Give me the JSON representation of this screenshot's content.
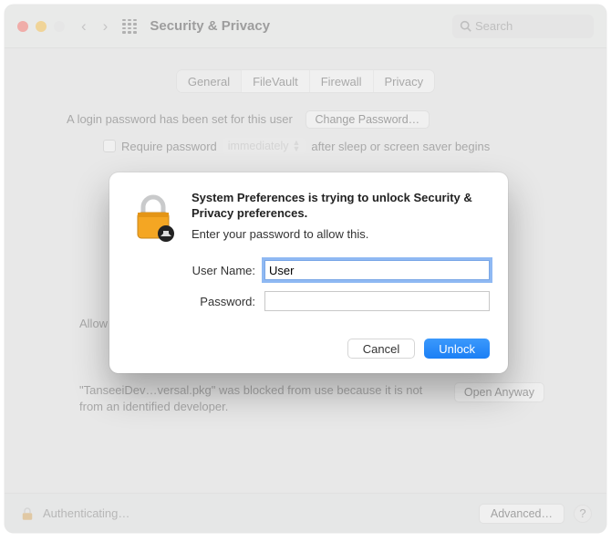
{
  "header": {
    "title": "Security & Privacy",
    "search_placeholder": "Search"
  },
  "tabs": [
    "General",
    "FileVault",
    "Firewall",
    "Privacy"
  ],
  "active_tab": 0,
  "content": {
    "login_password_text": "A login password has been set for this user",
    "change_password_label": "Change Password…",
    "require_password_label": "Require password",
    "require_password_delay": "immediately",
    "require_password_suffix": "after sleep or screen saver begins",
    "allow_prefix": "Allow",
    "blocked_text": "\"TanseeiDev…versal.pkg\" was blocked from use because it is not from an identified developer.",
    "open_anyway_label": "Open Anyway"
  },
  "dialog": {
    "title": "System Preferences is trying to unlock Security & Privacy preferences.",
    "subtitle": "Enter your password to allow this.",
    "username_label": "User Name:",
    "username_value": "User",
    "password_label": "Password:",
    "password_value": "",
    "cancel_label": "Cancel",
    "unlock_label": "Unlock"
  },
  "bottom": {
    "auth_text": "Authenticating…",
    "advanced_label": "Advanced…"
  }
}
